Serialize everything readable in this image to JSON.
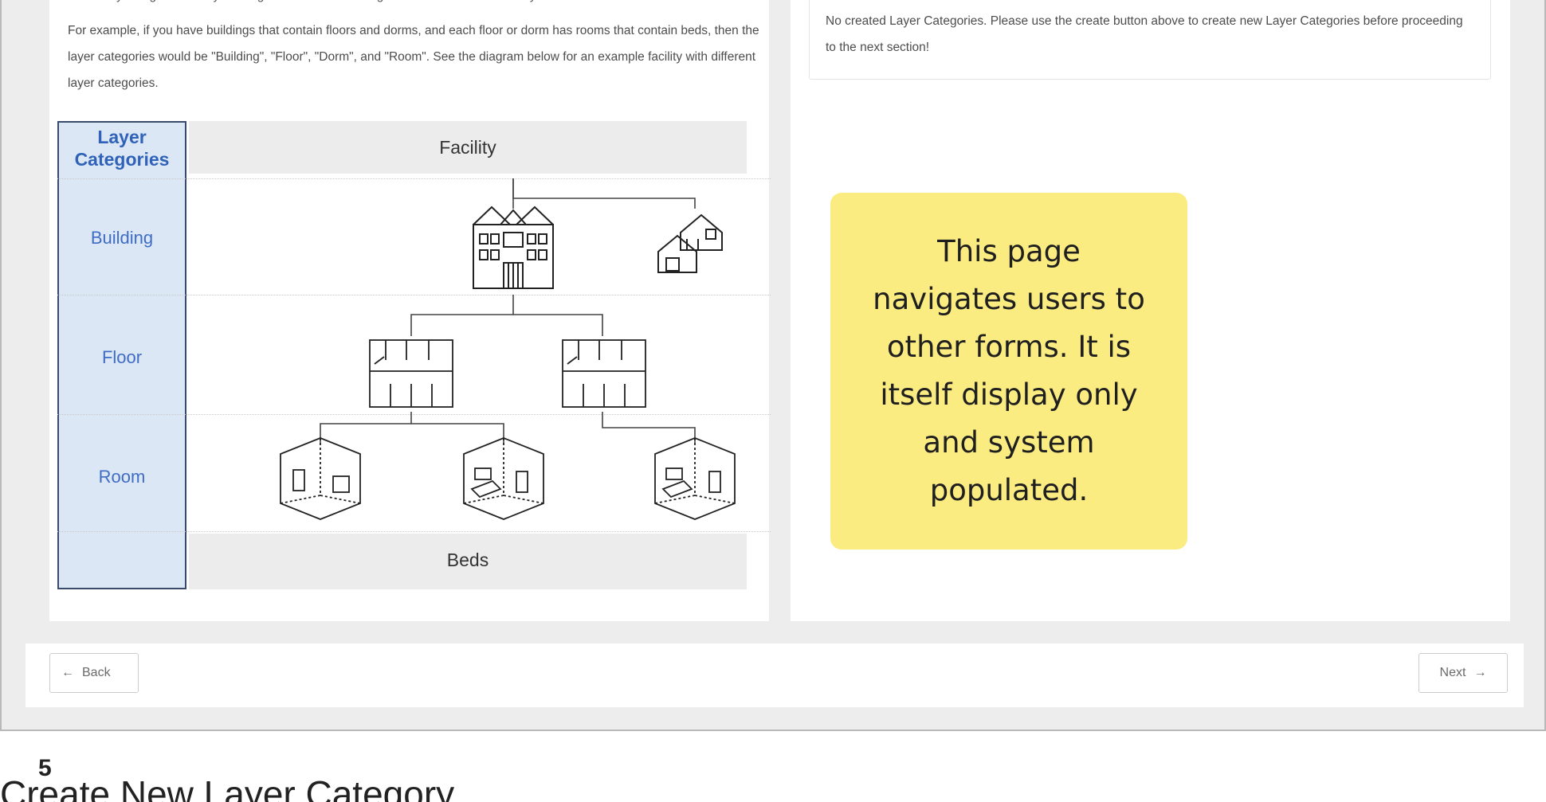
{
  "intro": {
    "top_line": "the facility is organized. Layer categories are the names given to each hierarchical layer.",
    "paragraph": "For example, if you have buildings that contain floors and dorms, and each floor or dorm has rooms that contain beds, then the layer categories would be \"Building\", \"Floor\", \"Dorm\", and \"Room\". See the diagram below for an example facility with different layer categories."
  },
  "diagram": {
    "header": "Layer Categories",
    "categories": [
      "Building",
      "Floor",
      "Room"
    ],
    "top_band": "Facility",
    "bottom_band": "Beds"
  },
  "message": {
    "text": "No created Layer Categories. Please use the create button above to create new Layer Categories before proceeding to the next section!"
  },
  "note": {
    "text": "This page navigates users to other forms. It is itself display only and system populated."
  },
  "footer": {
    "back_label": "Back",
    "next_label": "Next"
  },
  "step": {
    "number": "5",
    "title": "Create New Layer Category"
  },
  "colors": {
    "note_background": "#fbec82",
    "category_text": "#3f6dc4",
    "category_column": "#dce7f5"
  },
  "icons": [
    "arrow-left-icon",
    "arrow-right-icon",
    "building-icon",
    "house-icon",
    "floor-plan-icon",
    "room-icon"
  ]
}
